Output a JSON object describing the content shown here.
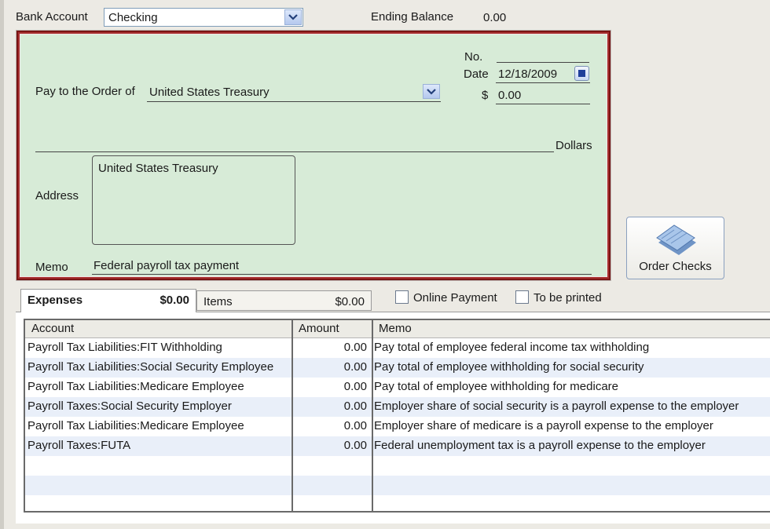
{
  "top": {
    "bank_account_label": "Bank Account",
    "bank_account_value": "Checking",
    "ending_balance_label": "Ending Balance",
    "ending_balance_value": "0.00"
  },
  "check": {
    "no_label": "No.",
    "no_value": "",
    "date_label": "Date",
    "date_value": "12/18/2009",
    "dollar_sign": "$",
    "amount_value": "0.00",
    "pay_to_label": "Pay to the Order of",
    "pay_to_value": "United States Treasury",
    "dollars_label": "Dollars",
    "address_label": "Address",
    "address_value": "United States Treasury",
    "memo_label": "Memo",
    "memo_value": "Federal payroll tax payment"
  },
  "order_checks_label": "Order Checks",
  "tabs": [
    {
      "name": "Expenses",
      "amount": "$0.00"
    },
    {
      "name": "Items",
      "amount": "$0.00"
    }
  ],
  "options": {
    "online_payment_label": "Online Payment",
    "online_payment_checked": false,
    "to_be_printed_label": "To be printed",
    "to_be_printed_checked": false
  },
  "table": {
    "columns": [
      "Account",
      "Amount",
      "Memo"
    ],
    "rows": [
      {
        "account": "Payroll Tax Liabilities:FIT Withholding",
        "amount": "0.00",
        "memo": "Pay total of employee federal income tax withholding"
      },
      {
        "account": "Payroll Tax Liabilities:Social Security Employee",
        "amount": "0.00",
        "memo": "Pay total of employee withholding for social security"
      },
      {
        "account": "Payroll Tax Liabilities:Medicare Employee",
        "amount": "0.00",
        "memo": "Pay total of employee withholding for medicare"
      },
      {
        "account": "Payroll Taxes:Social Security Employer",
        "amount": "0.00",
        "memo": "Employer share of social security is a payroll expense to the employer"
      },
      {
        "account": "Payroll Tax Liabilities:Medicare Employee",
        "amount": "0.00",
        "memo": "Employer share of medicare is a payroll expense to the employer"
      },
      {
        "account": "Payroll Taxes:FUTA",
        "amount": "0.00",
        "memo": "Federal unemployment tax is a payroll expense to the employer"
      },
      {
        "account": "",
        "amount": "",
        "memo": ""
      },
      {
        "account": "",
        "amount": "",
        "memo": ""
      },
      {
        "account": "",
        "amount": "",
        "memo": ""
      }
    ]
  },
  "colors": {
    "check_bg": "#d7ebd7",
    "check_border": "#7a1414",
    "row_alt": "#e9eff9"
  }
}
